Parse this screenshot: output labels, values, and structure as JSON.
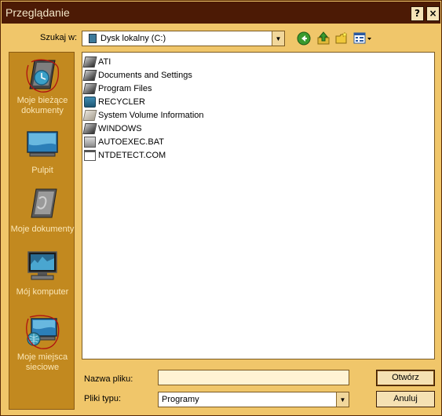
{
  "window": {
    "title": "Przeglądanie"
  },
  "titlebar": {
    "help_label": "?",
    "close_label": "×"
  },
  "lookin": {
    "label": "Szukaj w:",
    "value": "Dysk lokalny (C:)"
  },
  "places": [
    {
      "id": "recent",
      "label": "Moje bieżące dokumenty"
    },
    {
      "id": "desktop",
      "label": "Pulpit"
    },
    {
      "id": "mydocs",
      "label": "Moje dokumenty"
    },
    {
      "id": "mycomputer",
      "label": "Mój komputer"
    },
    {
      "id": "network",
      "label": "Moje miejsca sieciowe"
    }
  ],
  "files": [
    {
      "name": "ATI",
      "icon": "folder-icon"
    },
    {
      "name": "Documents and Settings",
      "icon": "folder-icon"
    },
    {
      "name": "Program Files",
      "icon": "folder-icon"
    },
    {
      "name": "RECYCLER",
      "icon": "recycle-bin-icon"
    },
    {
      "name": "System Volume Information",
      "icon": "folder-icon"
    },
    {
      "name": "WINDOWS",
      "icon": "folder-icon"
    },
    {
      "name": "AUTOEXEC.BAT",
      "icon": "batch-file-icon"
    },
    {
      "name": "NTDETECT.COM",
      "icon": "application-file-icon"
    }
  ],
  "filename": {
    "label": "Nazwa pliku:",
    "value": ""
  },
  "filetype": {
    "label": "Pliki typu:",
    "value": "Programy"
  },
  "buttons": {
    "open_label": "Otwórz",
    "cancel_label": "Anuluj"
  },
  "colors": {
    "titlebar": "#4c1a05",
    "dialog": "#f0c66a",
    "places_bar": "#c2891f"
  }
}
